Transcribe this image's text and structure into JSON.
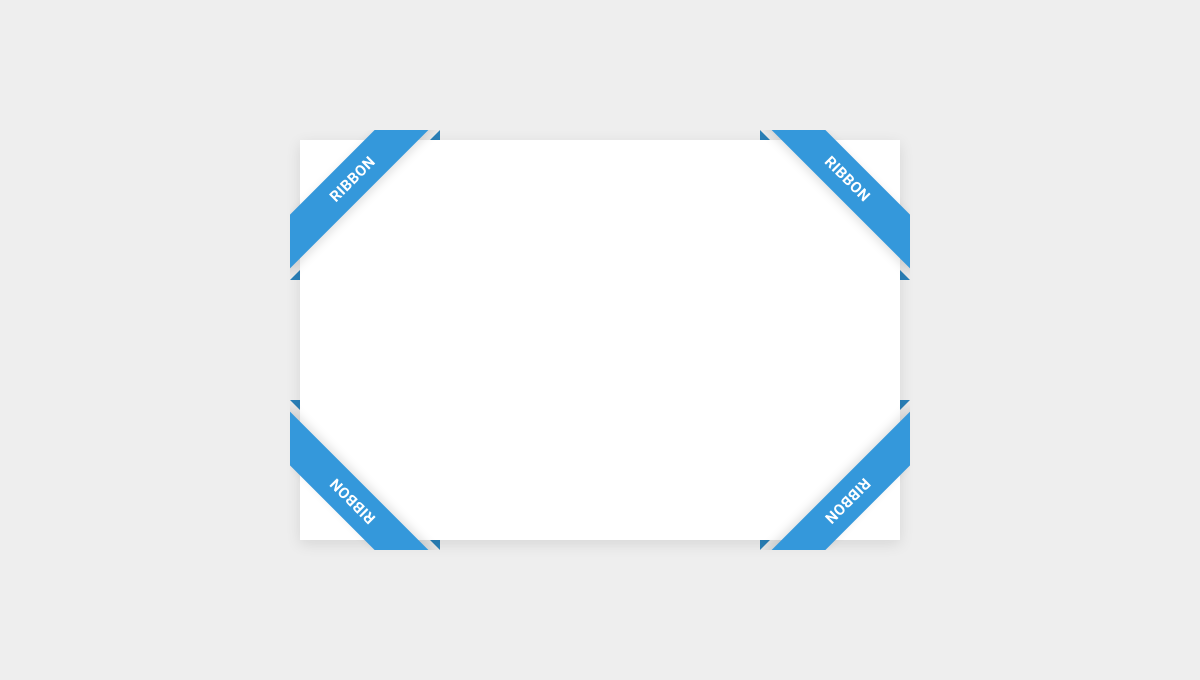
{
  "colors": {
    "page_bg": "#eeeeee",
    "box_bg": "#ffffff",
    "ribbon_bg": "#3498db",
    "ribbon_fold": "#2980b9",
    "ribbon_text": "#ffffff"
  },
  "ribbons": {
    "top_left": {
      "label": "RIBBON"
    },
    "top_right": {
      "label": "RIBBON"
    },
    "bottom_left": {
      "label": "RIBBON"
    },
    "bottom_right": {
      "label": "RIBBON"
    }
  }
}
